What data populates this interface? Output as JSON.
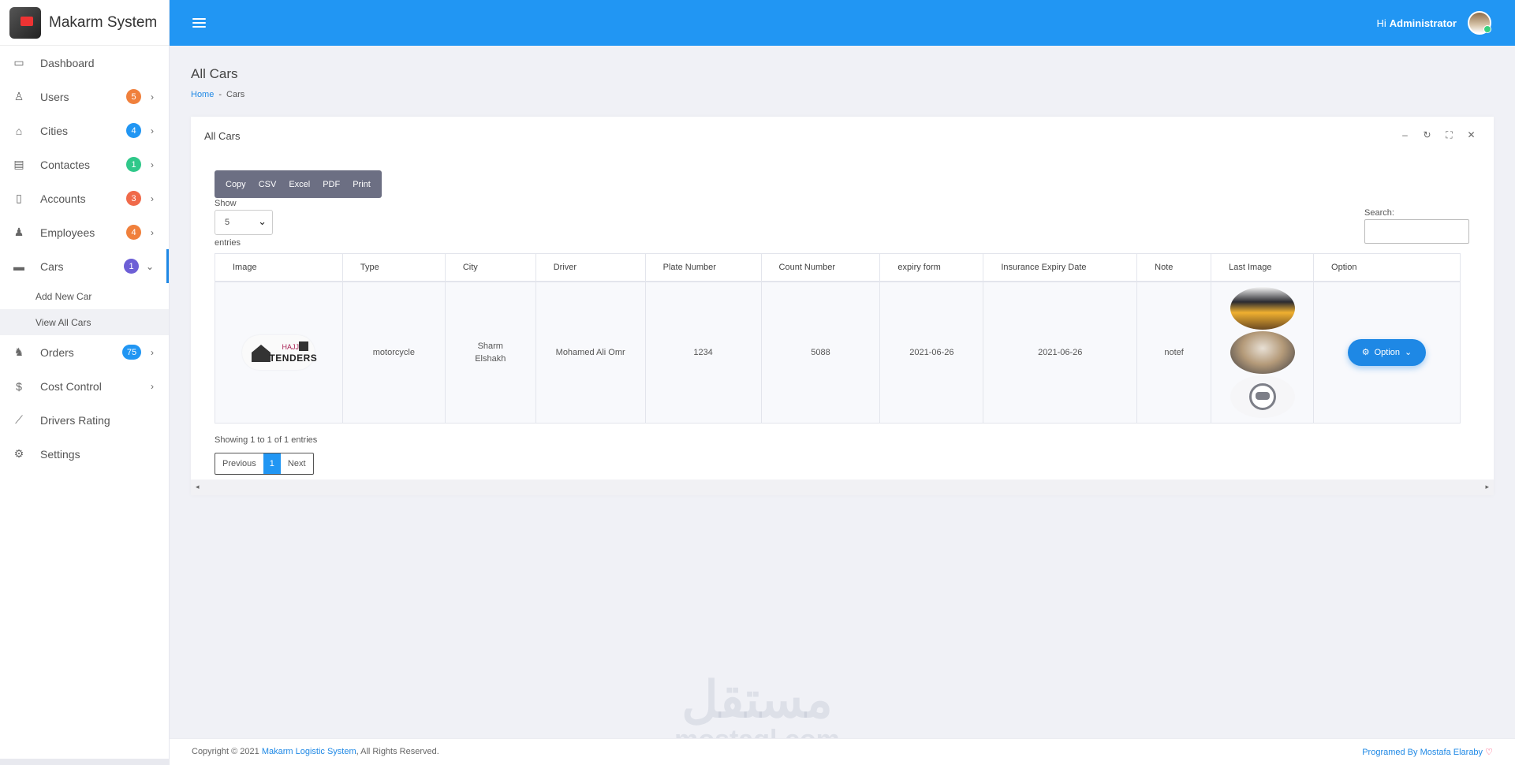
{
  "brand": {
    "title": "Makarm System"
  },
  "sidebar": {
    "items": [
      {
        "label": "Dashboard",
        "icon": "monitor-icon",
        "glyph": "▭"
      },
      {
        "label": "Users",
        "icon": "users-icon",
        "glyph": "♙",
        "badge": "5",
        "badge_color": "#f0803c"
      },
      {
        "label": "Cities",
        "icon": "home-icon",
        "glyph": "⌂",
        "badge": "4",
        "badge_color": "#2196f3"
      },
      {
        "label": "Contactes",
        "icon": "contact-card-icon",
        "glyph": "▤",
        "badge": "1",
        "badge_color": "#30c88a"
      },
      {
        "label": "Accounts",
        "icon": "mobile-icon",
        "glyph": "▯",
        "badge": "3",
        "badge_color": "#f06a4a"
      },
      {
        "label": "Employees",
        "icon": "employees-icon",
        "glyph": "♟",
        "badge": "4",
        "badge_color": "#f0803c"
      },
      {
        "label": "Cars",
        "icon": "car-icon",
        "glyph": "🚘",
        "badge": "1",
        "badge_color": "#6d5fd6"
      },
      {
        "label": "Orders",
        "icon": "orders-people-icon",
        "glyph": "♞",
        "badge": "75",
        "badge_color": "#2196f3"
      },
      {
        "label": "Cost Control",
        "icon": "dollar-icon",
        "glyph": "$"
      },
      {
        "label": "Drivers Rating",
        "icon": "chart-line-icon",
        "glyph": "⟋"
      },
      {
        "label": "Settings",
        "icon": "gears-icon",
        "glyph": "⚙"
      }
    ],
    "sub": {
      "add": "Add New Car",
      "view": "View All Cars"
    }
  },
  "header": {
    "hi": "Hi",
    "user": "Administrator"
  },
  "page": {
    "title": "All Cars",
    "crumb_home": "Home",
    "crumb_sep": "-",
    "crumb_current": "Cars"
  },
  "card": {
    "title": "All Cars",
    "export_buttons": [
      "Copy",
      "CSV",
      "Excel",
      "PDF",
      "Print"
    ],
    "show_label": "Show",
    "show_value": "5",
    "entries_label": "entries",
    "search_label": "Search:",
    "columns": [
      "Image",
      "Type",
      "City",
      "Driver",
      "Plate Number",
      "Count Number",
      "expiry form",
      "Insurance Expiry Date",
      "Note",
      "Last Image",
      "Option"
    ],
    "row": {
      "image_logo_text": "TENDERS",
      "image_logo_small": "HAJJ",
      "type": "motorcycle",
      "city": "Sharm Elshakh",
      "driver": "Mohamed Ali Omr",
      "plate": "1234",
      "count": "5088",
      "expiry": "2021-06-26",
      "insurance": "2021-06-26",
      "note": "notef",
      "option": "Option"
    },
    "showing": "Showing 1 to 1 of 1 entries",
    "pager": {
      "prev": "Previous",
      "page": "1",
      "next": "Next"
    }
  },
  "watermark": {
    "ar": "مستقل",
    "en": "mostaql.com"
  },
  "footer": {
    "prefix": "Copyright © 2021 ",
    "company": "Makarm Logistic System",
    "suffix": ", All Rights Reserved.",
    "credit": "Programed By Mostafa Elaraby"
  }
}
